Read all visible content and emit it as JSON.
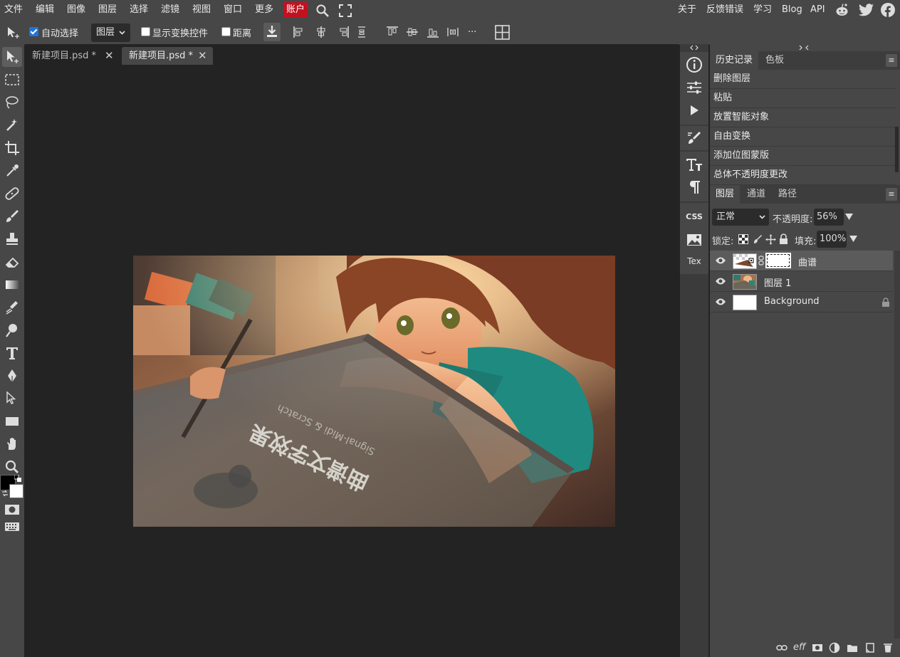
{
  "menubar": {
    "items": [
      "文件",
      "编辑",
      "图像",
      "图层",
      "选择",
      "滤镜",
      "视图",
      "窗口",
      "更多",
      "账户"
    ],
    "right_links": [
      "关于",
      "反馈错误",
      "学习",
      "Blog",
      "API"
    ],
    "icons": [
      "search-icon",
      "fullscreen-icon",
      "reddit-icon",
      "twitter-icon",
      "facebook-icon"
    ]
  },
  "options": {
    "auto_select_label": "自动选择",
    "auto_select_checked": true,
    "target_select": "图层",
    "show_transform_label": "显示变换控件",
    "distance_label": "距离",
    "more_label": "..."
  },
  "tabs": [
    {
      "label": "新建项目.psd *",
      "active": false
    },
    {
      "label": "新建项目.psd *",
      "active": true
    }
  ],
  "midcol": {
    "text_labels": [
      "CSS",
      "Tex"
    ]
  },
  "history": {
    "tabs": [
      "历史记录",
      "色板"
    ],
    "items": [
      "删除图层",
      "粘贴",
      "放置智能对象",
      "自由变换",
      "添加位图蒙版",
      "总体不透明度更改"
    ]
  },
  "layers": {
    "tabs": [
      "图层",
      "通道",
      "路径"
    ],
    "blend_mode": "正常",
    "opacity_label": "不透明度:",
    "opacity_value": "56%",
    "lock_label": "锁定:",
    "fill_label": "填充:",
    "fill_value": "100%",
    "rows": [
      {
        "name": "曲谱",
        "selected": true,
        "visible": true
      },
      {
        "name": "图层 1",
        "selected": false,
        "visible": true
      },
      {
        "name": "Background",
        "selected": false,
        "visible": true,
        "locked": true
      }
    ]
  },
  "colors": {
    "accent": "#c1121f",
    "foreground": "#000000",
    "background": "#ffffff"
  }
}
